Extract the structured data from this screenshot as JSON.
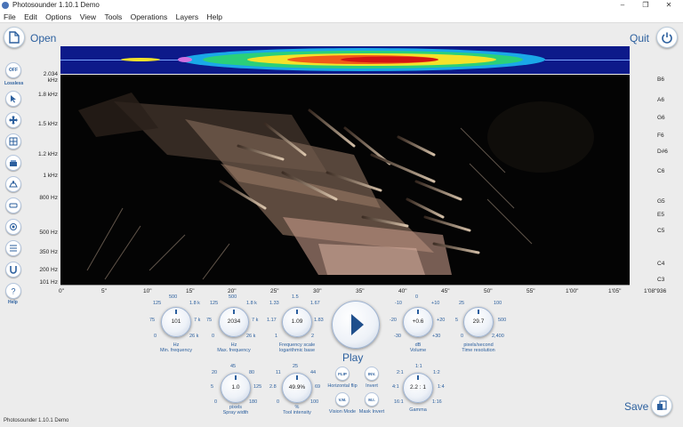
{
  "window": {
    "title": "Photosounder 1.10.1 Demo",
    "minimize": "–",
    "maximize": "❐",
    "close": "✕"
  },
  "menu": [
    "File",
    "Edit",
    "Options",
    "View",
    "Tools",
    "Operations",
    "Layers",
    "Help"
  ],
  "top": {
    "open_label": "Open",
    "quit_label": "Quit",
    "save_label": "Save"
  },
  "toolbar": {
    "lossless_label": "OFF",
    "lossless_caption": "Lossless",
    "help_caption": "Help"
  },
  "tools": [
    "cursor-tool-icon",
    "move-tool-icon",
    "grid-tool-icon",
    "bucket-tool-icon",
    "clear-tool-icon",
    "eraser-tool-icon",
    "brush-tool-icon",
    "filter-tool-icon",
    "magnet-tool-icon",
    "help-icon"
  ],
  "freq_labels": [
    "2.034 kHz",
    "1.8 kHz",
    "1.5 kHz",
    "1.2 kHz",
    "1 kHz",
    "800 Hz",
    "500 Hz",
    "350 Hz",
    "200 Hz",
    "101 Hz"
  ],
  "note_labels": [
    "B6",
    "A6",
    "G6",
    "F6",
    "D#6",
    "C6",
    "G5",
    "E5",
    "C5",
    "C4",
    "C3"
  ],
  "time_labels": [
    "0\"",
    "5\"",
    "10\"",
    "15\"",
    "20\"",
    "25\"",
    "30\"",
    "35\"",
    "40\"",
    "45\"",
    "50\"",
    "55\"",
    "1'00\"",
    "1'05\"",
    "1'08\"936"
  ],
  "knobs": {
    "min_freq": {
      "value": "101",
      "rings": [
        "125",
        "500",
        "1.8 k",
        "75",
        "7 k",
        "0",
        "26 k"
      ],
      "unit": "Hz",
      "caption": "Min. frequency"
    },
    "max_freq": {
      "value": "2034",
      "rings": [
        "125",
        "500",
        "1.8 k",
        "75",
        "7 k",
        "0",
        "26 k"
      ],
      "unit": "Hz",
      "caption": "Max. frequency"
    },
    "freq_scale": {
      "value": "1.09",
      "rings": [
        "1.33",
        "1.5",
        "1.67",
        "1.17",
        "1.83",
        "1",
        "2"
      ],
      "unit": "Frequency scale",
      "caption": "logarithmic base"
    },
    "volume": {
      "value": "+0.6",
      "rings": [
        "-10",
        "0",
        "+10",
        "-20",
        "+20",
        "-30",
        "+30"
      ],
      "unit": "dB",
      "caption": "Volume"
    },
    "time_res": {
      "value": "29.7",
      "rings": [
        "25",
        "100",
        "5",
        "500",
        "0",
        "2,400"
      ],
      "unit": "pixels/second",
      "caption": "Time resolution"
    },
    "spray_width": {
      "value": "1.0",
      "rings": [
        "20",
        "45",
        "80",
        "5",
        "125",
        "0",
        "180"
      ],
      "unit": "pixels",
      "caption": "Spray width"
    },
    "tool_intensity": {
      "value": "49.9%",
      "rings": [
        "11",
        "25",
        "44",
        "2.8",
        "69",
        "0",
        "100"
      ],
      "unit": "%",
      "caption": "Tool intensity"
    },
    "gamma": {
      "value": "2.2 : 1",
      "rings": [
        "1:1",
        "2:1",
        "1:2",
        "4:1",
        "1:4",
        "16:1",
        "1:16"
      ],
      "unit": "",
      "caption": "Gamma"
    }
  },
  "mini_buttons": {
    "flip": {
      "label": "FLIP",
      "caption": "Horizontal flip"
    },
    "inv": {
      "label": "INV.",
      "caption": "Invert"
    },
    "vm": {
      "label": "V.M.",
      "caption": "Vision Mode"
    },
    "mi": {
      "label": "M.I.",
      "caption": "Mask Invert"
    }
  },
  "play_label": "Play",
  "status": "Photosounder 1.10.1 Demo",
  "colors": {
    "accent": "#2b5f9e",
    "spectro_bg": "#040404",
    "overview_bg": "#0d1a8a"
  }
}
